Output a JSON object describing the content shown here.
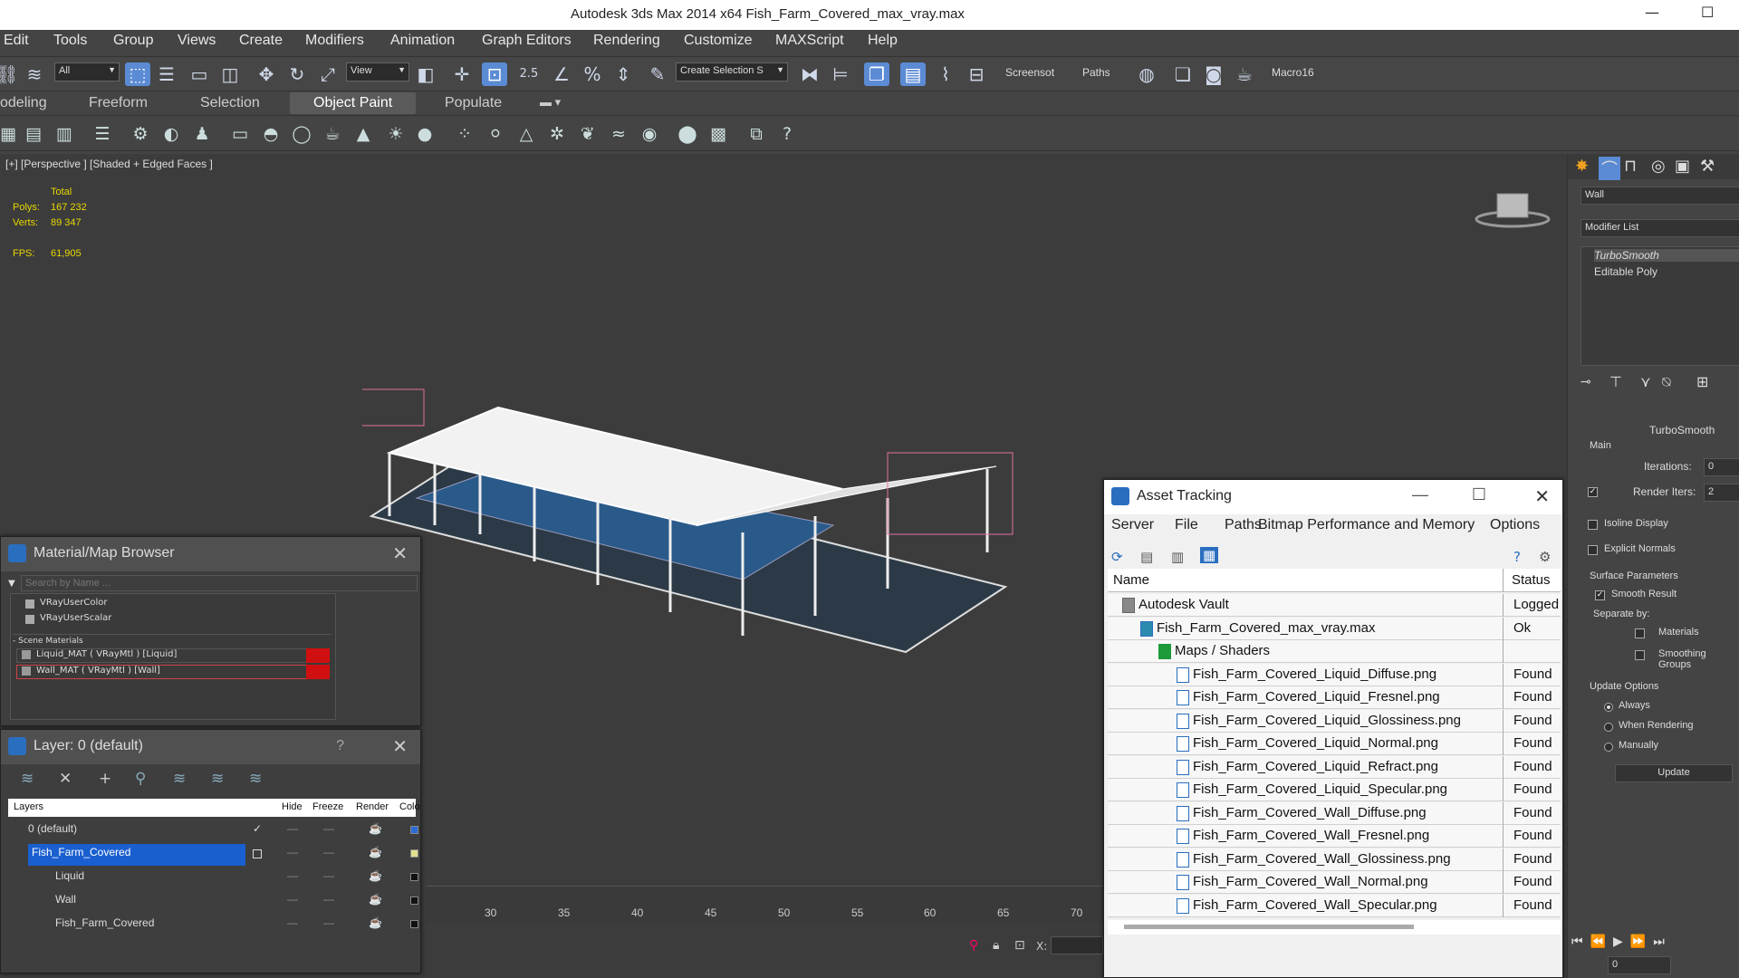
{
  "window": {
    "title": "Autodesk 3ds Max  2014 x64     Fish_Farm_Covered_max_vray.max",
    "minimize": "—",
    "maximize": "☐"
  },
  "menu": [
    "Edit",
    "Tools",
    "Group",
    "Views",
    "Create",
    "Modifiers",
    "Animation",
    "Graph Editors",
    "Rendering",
    "Customize",
    "MAXScript",
    "Help"
  ],
  "toolbar": {
    "filter_dropdown": "All",
    "view_dropdown": "View",
    "snap_label": "2.5",
    "selection_set": "Create Selection S",
    "screenshot_label": "Screensot",
    "paths_label": "Paths",
    "macro_label": "Macro16"
  },
  "ribbon": {
    "tabs": [
      "odeling",
      "Freeform",
      "Selection",
      "Object Paint",
      "Populate"
    ],
    "active": "Object Paint"
  },
  "viewport": {
    "label": "[+] [Perspective ] [Shaded + Edged Faces ]",
    "stats": {
      "total_label": "Total",
      "polys_label": "Polys:",
      "polys": "167 232",
      "verts_label": "Verts:",
      "verts": "89 347",
      "fps_label": "FPS:",
      "fps": "61,905"
    }
  },
  "command_panel": {
    "object_name": "Wall",
    "modifier_list_label": "Modifier List",
    "stack": [
      "TurboSmooth",
      "Editable Poly"
    ],
    "rollout_title": "TurboSmooth",
    "main_label": "Main",
    "iterations_label": "Iterations:",
    "iterations": "0",
    "render_iters_label": "Render Iters:",
    "render_iters": "2",
    "render_iters_checked": true,
    "isoline_label": "Isoline Display",
    "explicit_normals_label": "Explicit Normals",
    "surface_params_label": "Surface Parameters",
    "smooth_result_label": "Smooth Result",
    "separate_by_label": "Separate by:",
    "materials_label": "Materials",
    "smoothing_groups_label": "Smoothing Groups",
    "update_options_label": "Update Options",
    "always_label": "Always",
    "when_rendering_label": "When Rendering",
    "manually_label": "Manually",
    "update_button": "Update"
  },
  "material_browser": {
    "title": "Material/Map Browser",
    "search_placeholder": "Search by Name ...",
    "maps": [
      "VRayUserColor",
      "VRayUserScalar"
    ],
    "scene_materials_label": "- Scene Materials",
    "materials": [
      "Liquid_MAT ( VRayMtl ) [Liquid]",
      "Wall_MAT ( VRayMtl ) [Wall]"
    ]
  },
  "layer_manager": {
    "title": "Layer: 0 (default)",
    "help": "?",
    "columns": {
      "layers": "Layers",
      "hide": "Hide",
      "freeze": "Freeze",
      "render": "Render",
      "color": "Colo"
    },
    "rows": [
      {
        "name": "0 (default)",
        "indent": 0,
        "color": "#2b6cd6",
        "checked": true
      },
      {
        "name": "Fish_Farm_Covered",
        "indent": 0,
        "color": "#e0e090",
        "selected": true
      },
      {
        "name": "Liquid",
        "indent": 1,
        "color": "#111111"
      },
      {
        "name": "Wall",
        "indent": 1,
        "color": "#111111"
      },
      {
        "name": "Fish_Farm_Covered",
        "indent": 1,
        "color": "#111111"
      }
    ]
  },
  "asset_tracking": {
    "title": "Asset Tracking",
    "menu": [
      "Server",
      "File",
      "Paths",
      "Bitmap Performance and Memory",
      "Options"
    ],
    "col_name": "Name",
    "col_status": "Status",
    "rows": [
      {
        "name": "Autodesk Vault",
        "status": "Logged Out",
        "indent": 1
      },
      {
        "name": "Fish_Farm_Covered_max_vray.max",
        "status": "Ok",
        "indent": 2
      },
      {
        "name": "Maps / Shaders",
        "status": "",
        "indent": 3
      },
      {
        "name": "Fish_Farm_Covered_Liquid_Diffuse.png",
        "status": "Found",
        "indent": 4
      },
      {
        "name": "Fish_Farm_Covered_Liquid_Fresnel.png",
        "status": "Found",
        "indent": 4
      },
      {
        "name": "Fish_Farm_Covered_Liquid_Glossiness.png",
        "status": "Found",
        "indent": 4
      },
      {
        "name": "Fish_Farm_Covered_Liquid_Normal.png",
        "status": "Found",
        "indent": 4
      },
      {
        "name": "Fish_Farm_Covered_Liquid_Refract.png",
        "status": "Found",
        "indent": 4
      },
      {
        "name": "Fish_Farm_Covered_Liquid_Specular.png",
        "status": "Found",
        "indent": 4
      },
      {
        "name": "Fish_Farm_Covered_Wall_Diffuse.png",
        "status": "Found",
        "indent": 4
      },
      {
        "name": "Fish_Farm_Covered_Wall_Fresnel.png",
        "status": "Found",
        "indent": 4
      },
      {
        "name": "Fish_Farm_Covered_Wall_Glossiness.png",
        "status": "Found",
        "indent": 4
      },
      {
        "name": "Fish_Farm_Covered_Wall_Normal.png",
        "status": "Found",
        "indent": 4
      },
      {
        "name": "Fish_Farm_Covered_Wall_Specular.png",
        "status": "Found",
        "indent": 4
      }
    ]
  },
  "timeline": {
    "ticks": [
      "30",
      "35",
      "40",
      "45",
      "50",
      "55",
      "60",
      "65",
      "70"
    ],
    "x_label": "X:",
    "frame": "0"
  }
}
